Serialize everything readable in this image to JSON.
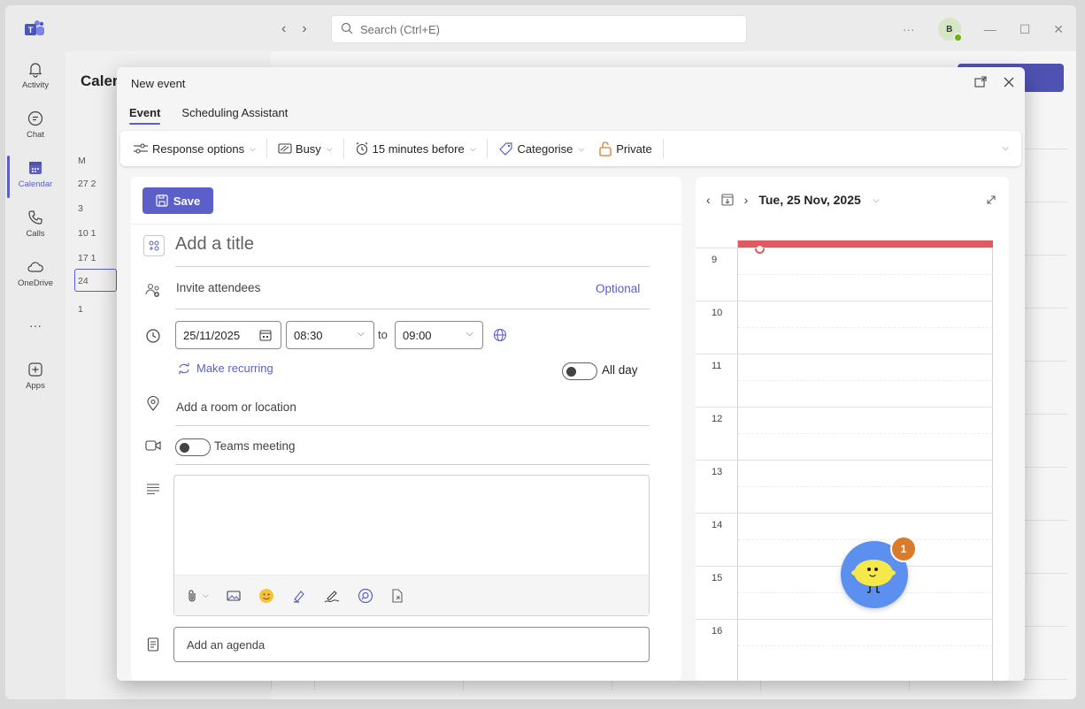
{
  "titlebar": {
    "search_placeholder": "Search (Ctrl+E)",
    "avatar_initial": "B",
    "more": "···",
    "minimize": "—",
    "maximize": "☐",
    "close": "✕"
  },
  "rail": {
    "items": [
      {
        "label": "Activity"
      },
      {
        "label": "Chat"
      },
      {
        "label": "Calendar"
      },
      {
        "label": "Calls"
      },
      {
        "label": "OneDrive"
      },
      {
        "label": "···"
      },
      {
        "label": "Apps"
      }
    ]
  },
  "background": {
    "title": "Caler",
    "mini_rows": [
      "M",
      "27  2",
      "3",
      "10  1",
      "17  1",
      "24",
      "1"
    ]
  },
  "modal": {
    "title": "New event",
    "tabs": [
      {
        "label": "Event",
        "active": true
      },
      {
        "label": "Scheduling Assistant",
        "active": false
      }
    ],
    "toolbar": {
      "response_options": "Response options",
      "busy": "Busy",
      "reminder": "15 minutes before",
      "categorise": "Categorise",
      "private": "Private"
    },
    "form": {
      "save_label": "Save",
      "title_placeholder": "Add a title",
      "invite_placeholder": "Invite attendees",
      "optional_label": "Optional",
      "start_date": "25/11/2025",
      "start_time": "08:30",
      "to_label": "to",
      "end_time": "09:00",
      "recurring_label": "Make recurring",
      "allday_label": "All day",
      "location_placeholder": "Add a room or location",
      "teams_meeting_label": "Teams meeting",
      "agenda_placeholder": "Add an agenda"
    },
    "calendar": {
      "date_label": "Tue, 25 Nov, 2025",
      "hours": [
        "9",
        "10",
        "11",
        "12",
        "13",
        "14",
        "15",
        "16"
      ]
    }
  },
  "copilot": {
    "badge_count": "1"
  },
  "colors": {
    "accent": "#5b5fc7",
    "now_line": "#e05a5f",
    "badge": "#d87c2b",
    "presence": "#6bb700"
  }
}
